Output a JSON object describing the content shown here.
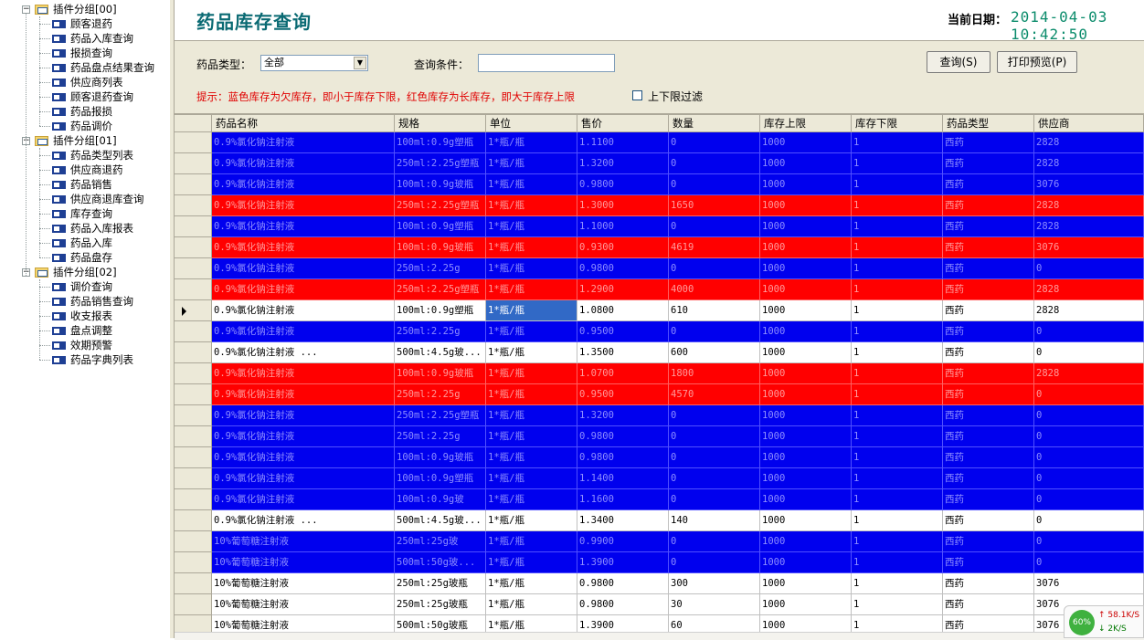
{
  "sidebar": {
    "groups": [
      {
        "label": "插件分组[00]",
        "items": [
          "顾客退药",
          "药品入库查询",
          "报损查询",
          "药品盘点结果查询",
          "供应商列表",
          "顾客退药查询",
          "药品报损",
          "药品调价"
        ]
      },
      {
        "label": "插件分组[01]",
        "items": [
          "药品类型列表",
          "供应商退药",
          "药品销售",
          "供应商退库查询",
          "库存查询",
          "药品入库报表",
          "药品入库",
          "药品盘存"
        ]
      },
      {
        "label": "插件分组[02]",
        "items": [
          "调价查询",
          "药品销售查询",
          "收支报表",
          "盘点调整",
          "效期预警",
          "药品字典列表"
        ]
      }
    ],
    "expander_symbol": "−"
  },
  "header": {
    "title": "药品库存查询",
    "date_label": "当前日期：",
    "date_value": "2014-04-03 10:42:50"
  },
  "filters": {
    "type_label": "药品类型：",
    "type_value": "全部",
    "type_arrow": "▼",
    "query_label": "查询条件：",
    "query_value": "",
    "query_button": "查询(S)",
    "print_button": "打印预览(P)",
    "hint": "提示：蓝色库存为欠库存，即小于库存下限，红色库存为长库存，即大于库存上限",
    "limit_filter_label": "上下限过滤",
    "limit_filter_checked": false
  },
  "grid": {
    "columns": [
      "药品名称",
      "规格",
      "单位",
      "售价",
      "数量",
      "库存上限",
      "库存下限",
      "药品类型",
      "供应商"
    ],
    "color_legend": {
      "blue": "#0000ee",
      "red": "#ff0000",
      "white": "#ffffff",
      "selected": "#3169c6"
    },
    "current_row_index": 8,
    "selected_column": "单位",
    "rows": [
      {
        "color": "blue",
        "cells": [
          "0.9%氯化钠注射液",
          "100ml:0.9g塑瓶",
          "1*瓶/瓶",
          "1.1100",
          "0",
          "1000",
          "1",
          "西药",
          "2828"
        ]
      },
      {
        "color": "blue",
        "cells": [
          "0.9%氯化钠注射液",
          "250ml:2.25g塑瓶",
          "1*瓶/瓶",
          "1.3200",
          "0",
          "1000",
          "1",
          "西药",
          "2828"
        ]
      },
      {
        "color": "blue",
        "cells": [
          "0.9%氯化钠注射液",
          "100ml:0.9g玻瓶",
          "1*瓶/瓶",
          "0.9800",
          "0",
          "1000",
          "1",
          "西药",
          "3076"
        ]
      },
      {
        "color": "red",
        "cells": [
          "0.9%氯化钠注射液",
          "250ml:2.25g塑瓶",
          "1*瓶/瓶",
          "1.3000",
          "1650",
          "1000",
          "1",
          "西药",
          "2828"
        ]
      },
      {
        "color": "blue",
        "cells": [
          "0.9%氯化钠注射液",
          "100ml:0.9g塑瓶",
          "1*瓶/瓶",
          "1.1000",
          "0",
          "1000",
          "1",
          "西药",
          "2828"
        ]
      },
      {
        "color": "red",
        "cells": [
          "0.9%氯化钠注射液",
          "100ml:0.9g玻瓶",
          "1*瓶/瓶",
          "0.9300",
          "4619",
          "1000",
          "1",
          "西药",
          "3076"
        ]
      },
      {
        "color": "blue",
        "cells": [
          "0.9%氯化钠注射液",
          "250ml:2.25g",
          "1*瓶/瓶",
          "0.9800",
          "0",
          "1000",
          "1",
          "西药",
          "0"
        ]
      },
      {
        "color": "red",
        "cells": [
          "0.9%氯化钠注射液",
          "250ml:2.25g塑瓶",
          "1*瓶/瓶",
          "1.2900",
          "4000",
          "1000",
          "1",
          "西药",
          "2828"
        ]
      },
      {
        "color": "white",
        "cells": [
          "0.9%氯化钠注射液",
          "100ml:0.9g塑瓶",
          "1*瓶/瓶",
          "1.0800",
          "610",
          "1000",
          "1",
          "西药",
          "2828"
        ]
      },
      {
        "color": "blue",
        "cells": [
          "0.9%氯化钠注射液",
          "250ml:2.25g",
          "1*瓶/瓶",
          "0.9500",
          "0",
          "1000",
          "1",
          "西药",
          "0"
        ]
      },
      {
        "color": "white",
        "cells": [
          "0.9%氯化钠注射液 ...",
          "500ml:4.5g玻...",
          "1*瓶/瓶",
          "1.3500",
          "600",
          "1000",
          "1",
          "西药",
          "0"
        ]
      },
      {
        "color": "red",
        "cells": [
          "0.9%氯化钠注射液",
          "100ml:0.9g玻瓶",
          "1*瓶/瓶",
          "1.0700",
          "1800",
          "1000",
          "1",
          "西药",
          "2828"
        ]
      },
      {
        "color": "red",
        "cells": [
          "0.9%氯化钠注射液",
          "250ml:2.25g",
          "1*瓶/瓶",
          "0.9500",
          "4570",
          "1000",
          "1",
          "西药",
          "0"
        ]
      },
      {
        "color": "blue",
        "cells": [
          "0.9%氯化钠注射液",
          "250ml:2.25g塑瓶",
          "1*瓶/瓶",
          "1.3200",
          "0",
          "1000",
          "1",
          "西药",
          "0"
        ]
      },
      {
        "color": "blue",
        "cells": [
          "0.9%氯化钠注射液",
          "250ml:2.25g",
          "1*瓶/瓶",
          "0.9800",
          "0",
          "1000",
          "1",
          "西药",
          "0"
        ]
      },
      {
        "color": "blue",
        "cells": [
          "0.9%氯化钠注射液",
          "100ml:0.9g玻瓶",
          "1*瓶/瓶",
          "0.9800",
          "0",
          "1000",
          "1",
          "西药",
          "0"
        ]
      },
      {
        "color": "blue",
        "cells": [
          "0.9%氯化钠注射液",
          "100ml:0.9g塑瓶",
          "1*瓶/瓶",
          "1.1400",
          "0",
          "1000",
          "1",
          "西药",
          "0"
        ]
      },
      {
        "color": "blue",
        "cells": [
          "0.9%氯化钠注射液",
          "100ml:0.9g玻",
          "1*瓶/瓶",
          "1.1600",
          "0",
          "1000",
          "1",
          "西药",
          "0"
        ]
      },
      {
        "color": "white",
        "cells": [
          "0.9%氯化钠注射液 ...",
          "500ml:4.5g玻...",
          "1*瓶/瓶",
          "1.3400",
          "140",
          "1000",
          "1",
          "西药",
          "0"
        ]
      },
      {
        "color": "blue",
        "cells": [
          "10%葡萄糖注射液",
          "250ml:25g玻",
          "1*瓶/瓶",
          "0.9900",
          "0",
          "1000",
          "1",
          "西药",
          "0"
        ]
      },
      {
        "color": "blue",
        "cells": [
          "10%葡萄糖注射液",
          "500ml:50g玻...",
          "1*瓶/瓶",
          "1.3900",
          "0",
          "1000",
          "1",
          "西药",
          "0"
        ]
      },
      {
        "color": "white",
        "cells": [
          "10%葡萄糖注射液",
          "250ml:25g玻瓶",
          "1*瓶/瓶",
          "0.9800",
          "300",
          "1000",
          "1",
          "西药",
          "3076"
        ]
      },
      {
        "color": "white",
        "cells": [
          "10%葡萄糖注射液",
          "250ml:25g玻瓶",
          "1*瓶/瓶",
          "0.9800",
          "30",
          "1000",
          "1",
          "西药",
          "3076"
        ]
      },
      {
        "color": "white",
        "cells": [
          "10%葡萄糖注射液",
          "500ml:50g玻瓶",
          "1*瓶/瓶",
          "1.3900",
          "60",
          "1000",
          "1",
          "西药",
          "3076"
        ]
      }
    ]
  },
  "tray": {
    "cpu_percent": "60%",
    "upload": "↑ 58.1K/S",
    "download": "↓  2K/S"
  }
}
